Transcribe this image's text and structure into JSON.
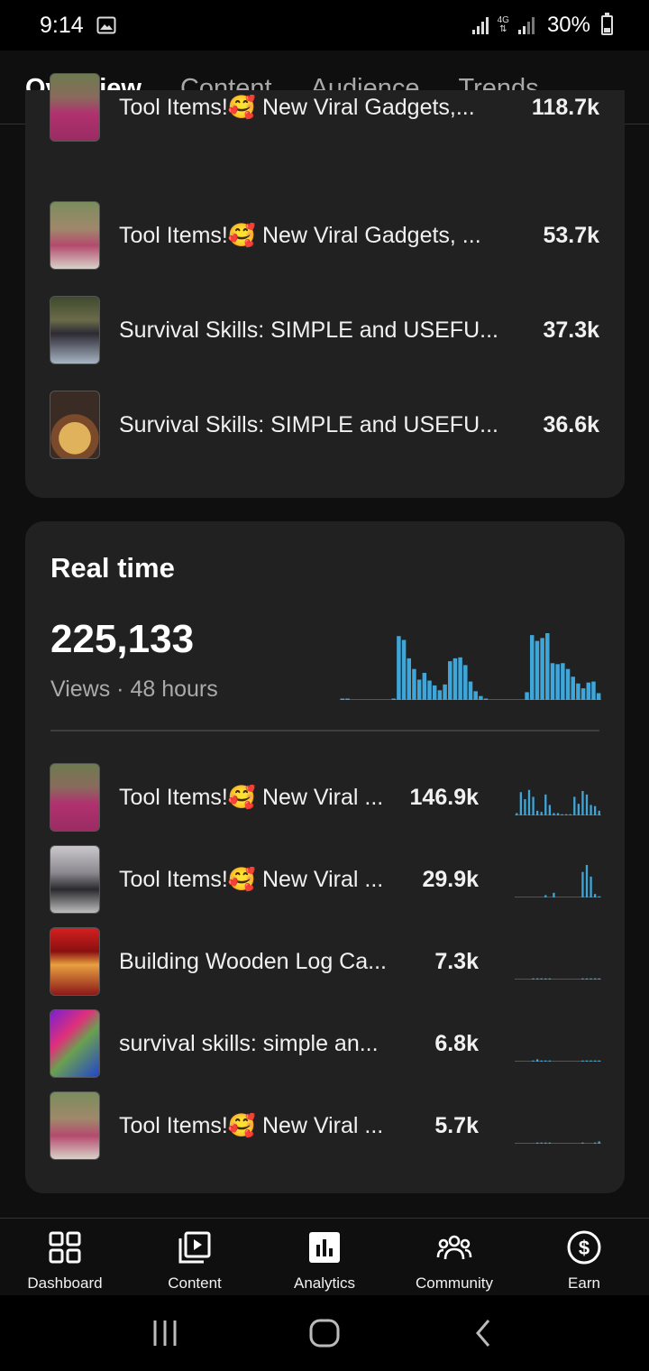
{
  "status_bar": {
    "time": "9:14",
    "network": "4G",
    "battery": "30%"
  },
  "tabs": [
    {
      "label": "Overview",
      "active": true
    },
    {
      "label": "Content",
      "active": false
    },
    {
      "label": "Audience",
      "active": false
    },
    {
      "label": "Trends",
      "active": false
    }
  ],
  "top_content": {
    "items": [
      {
        "title": "Tool Items!🥰 New Viral Gadgets,...",
        "value": "118.7k"
      },
      {
        "title": "Tool Items!🥰 New Viral Gadgets, ...",
        "value": "53.7k"
      },
      {
        "title": "Survival Skills: SIMPLE and USEFU...",
        "value": "37.3k"
      },
      {
        "title": "Survival Skills: SIMPLE and USEFU...",
        "value": "36.6k"
      }
    ]
  },
  "realtime": {
    "title": "Real time",
    "views": "225,133",
    "subtitle": "Views · 48 hours",
    "chart_data": {
      "type": "bar",
      "color": "#3ea6d8",
      "values": [
        1,
        1,
        0,
        0,
        0,
        0,
        0,
        0,
        0,
        0,
        1,
        66,
        62,
        43,
        32,
        21,
        28,
        20,
        15,
        10,
        16,
        40,
        43,
        44,
        36,
        19,
        9,
        4,
        1,
        0,
        0,
        0,
        0,
        0,
        0,
        0,
        8,
        67,
        61,
        64,
        69,
        38,
        37,
        38,
        32,
        24,
        17,
        12,
        18,
        19,
        7
      ]
    },
    "items": [
      {
        "title": "Tool Items!🥰 New Viral ...",
        "value": "146.9k",
        "spark": [
          2,
          20,
          14,
          22,
          16,
          4,
          3,
          18,
          9,
          2,
          2,
          1,
          1,
          1,
          16,
          10,
          21,
          18,
          9,
          8,
          4
        ]
      },
      {
        "title": "Tool Items!🥰 New Viral ...",
        "value": "29.9k",
        "spark": [
          0,
          0,
          0,
          0,
          0,
          0,
          0,
          2,
          0,
          4,
          0,
          0,
          0,
          0,
          0,
          0,
          22,
          28,
          18,
          3,
          1
        ]
      },
      {
        "title": "Building Wooden Log Ca...",
        "value": "7.3k",
        "spark": [
          0,
          0,
          0,
          0,
          1,
          1,
          1,
          1,
          1,
          0,
          0,
          0,
          0,
          0,
          0,
          0,
          1,
          1,
          1,
          1,
          1
        ]
      },
      {
        "title": "survival skills: simple an...",
        "value": "6.8k",
        "spark": [
          0,
          0,
          0,
          0,
          1,
          2,
          1,
          1,
          1,
          0,
          0,
          0,
          0,
          0,
          0,
          0,
          1,
          1,
          1,
          1,
          1
        ]
      },
      {
        "title": "Tool Items!🥰 New Viral ...",
        "value": "5.7k",
        "spark": [
          0,
          0,
          0,
          0,
          0,
          1,
          1,
          1,
          1,
          0,
          0,
          0,
          0,
          0,
          0,
          0,
          1,
          0,
          0,
          1,
          2
        ]
      }
    ]
  },
  "bottom_nav": [
    {
      "label": "Dashboard",
      "icon": "dashboard-icon"
    },
    {
      "label": "Content",
      "icon": "content-icon"
    },
    {
      "label": "Analytics",
      "icon": "analytics-icon",
      "active": true
    },
    {
      "label": "Community",
      "icon": "community-icon"
    },
    {
      "label": "Earn",
      "icon": "earn-icon"
    }
  ]
}
